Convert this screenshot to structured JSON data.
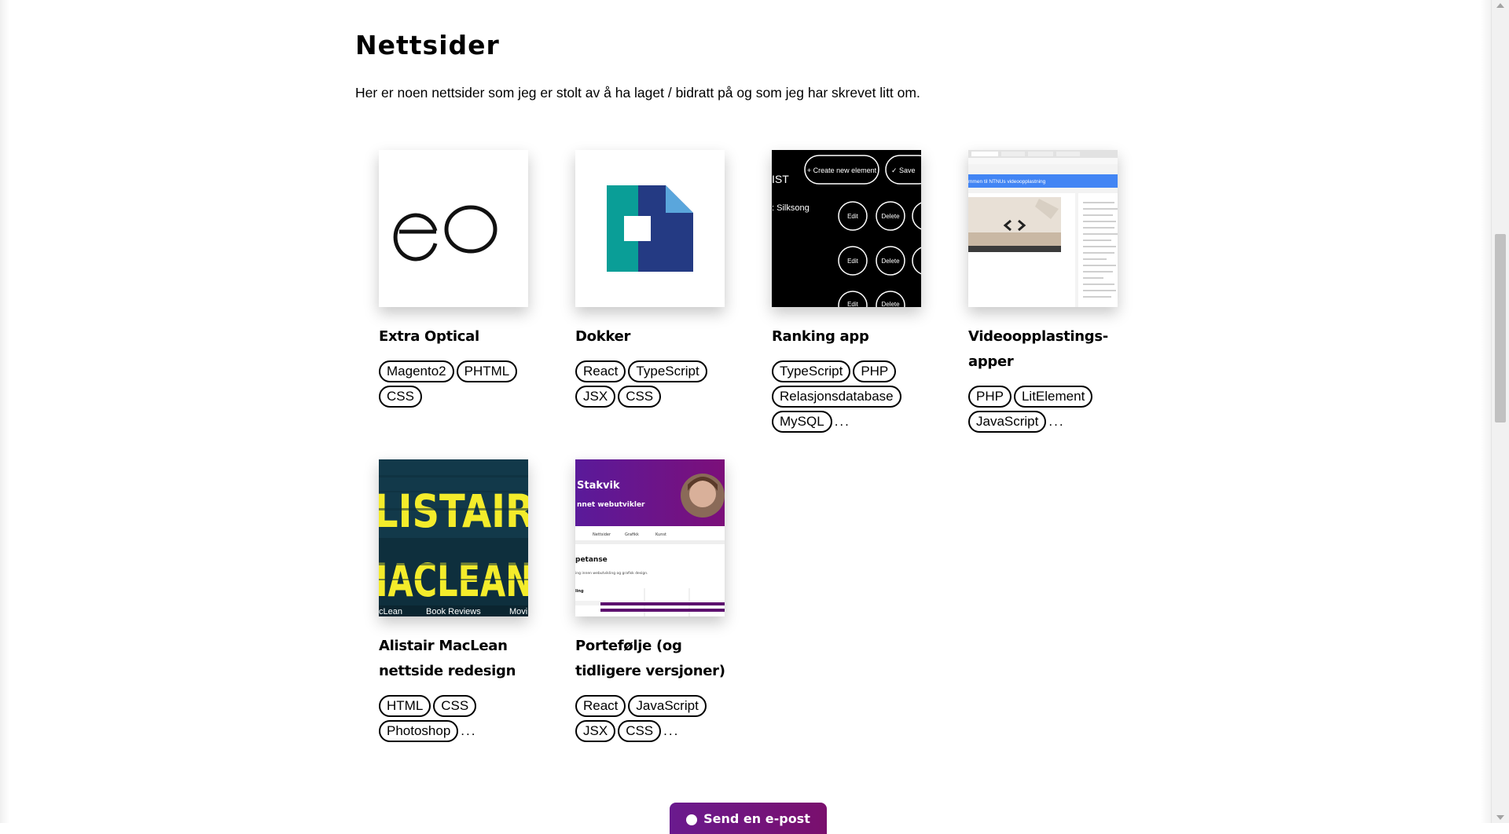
{
  "section": {
    "title": "Nettsider",
    "intro": "Her er noen nettsider som jeg er stolt av å ha laget / bidratt på og som jeg har skrevet litt om."
  },
  "projects": [
    {
      "title": "Extra Optical",
      "tags": [
        "Magento2",
        "PHTML",
        "CSS"
      ],
      "more": ""
    },
    {
      "title": "Dokker",
      "tags": [
        "React",
        "TypeScript",
        "JSX",
        "CSS"
      ],
      "more": ""
    },
    {
      "title": "Ranking app",
      "tags": [
        "TypeScript",
        "PHP",
        "Relasjonsdatabase",
        "MySQL"
      ],
      "more": "...",
      "thumb": {
        "create_label": "+ Create new element",
        "save_label": "✓ Save",
        "list_label": "IST",
        "item_label": ": Silksong",
        "edit_label": "Edit",
        "delete_label": "Delete"
      }
    },
    {
      "title": "Videoopplastings-apper",
      "tags": [
        "PHP",
        "LitElement",
        "JavaScript"
      ],
      "more": "...",
      "thumb": {
        "header_label": "mmen til NTNUs videoopplastning"
      }
    },
    {
      "title": "Alistair MacLean nettside redesign",
      "tags": [
        "HTML",
        "CSS",
        "Photoshop"
      ],
      "more": "...",
      "thumb": {
        "line1": "LISTAIR",
        "line2": "IACLEAN",
        "nav1": "cLean",
        "nav2": "Book Reviews",
        "nav3": "Movi"
      }
    },
    {
      "title": "Portefølje (og tidligere versjoner)",
      "tags": [
        "React",
        "JavaScript",
        "JSX",
        "CSS"
      ],
      "more": "...",
      "thumb": {
        "name": "Stakvik",
        "role": "nnet webutvikler",
        "nav1": "Nettsider",
        "nav2": "Grafikk",
        "nav3": "Kunst",
        "heading": "petanse",
        "sub": "ing innen webutvikling og grafisk design.",
        "row_label": "ling"
      }
    }
  ],
  "contact_button": {
    "label": "Send en e-post"
  },
  "colors": {
    "accent": "#6a1a8e",
    "dokker_teal": "#0a9e97",
    "dokker_navy": "#243a83",
    "dokker_light": "#5aa6dc",
    "video_blue": "#4285f4",
    "maclean_yellow": "#f4ec2b"
  }
}
